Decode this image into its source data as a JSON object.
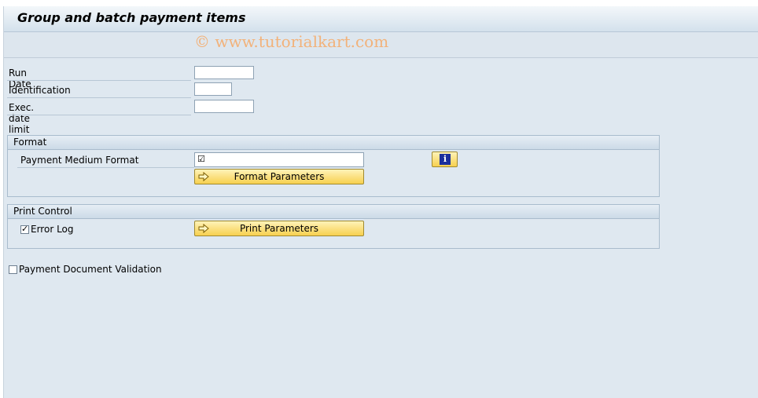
{
  "header": {
    "title": "Group and batch payment items",
    "watermark": "© www.tutorialkart.com"
  },
  "fields": {
    "run_date": {
      "label": "Run Date",
      "value": ""
    },
    "identification": {
      "label": "Identification",
      "value": ""
    },
    "exec_date_limit": {
      "label": "Exec. date limit",
      "value": ""
    }
  },
  "format_group": {
    "title": "Format",
    "payment_medium_label": "Payment Medium Format",
    "payment_medium_value": "",
    "payment_medium_check_glyph": "☑",
    "format_params_button": "Format Parameters",
    "info_icon": "info-icon"
  },
  "print_group": {
    "title": "Print Control",
    "error_log_label": "Error Log",
    "error_log_checked": true,
    "print_params_button": "Print Parameters"
  },
  "payment_doc_validation": {
    "label": "Payment Document Validation",
    "checked": false
  },
  "colors": {
    "background": "#dfe8f0",
    "button": "#f7d04f",
    "info_icon": "#1b2f9c",
    "watermark": "#f2b27a"
  }
}
